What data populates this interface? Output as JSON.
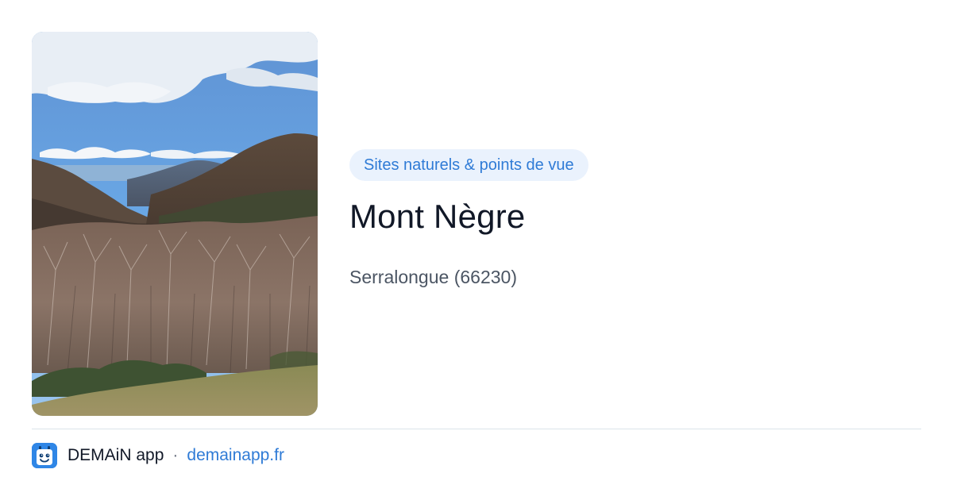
{
  "place": {
    "category": "Sites naturels & points de vue",
    "title": "Mont Nègre",
    "location": "Serralongue (66230)"
  },
  "footer": {
    "app_name": "DEMAiN app",
    "separator": "·",
    "link_text": "demainapp.fr",
    "logo_icon": "calendar-face-icon"
  },
  "colors": {
    "accent": "#2f7bd6",
    "badge_background": "#eaf2fd",
    "logo_background": "#2f86e6",
    "title": "#111827",
    "muted": "#4b5563"
  }
}
